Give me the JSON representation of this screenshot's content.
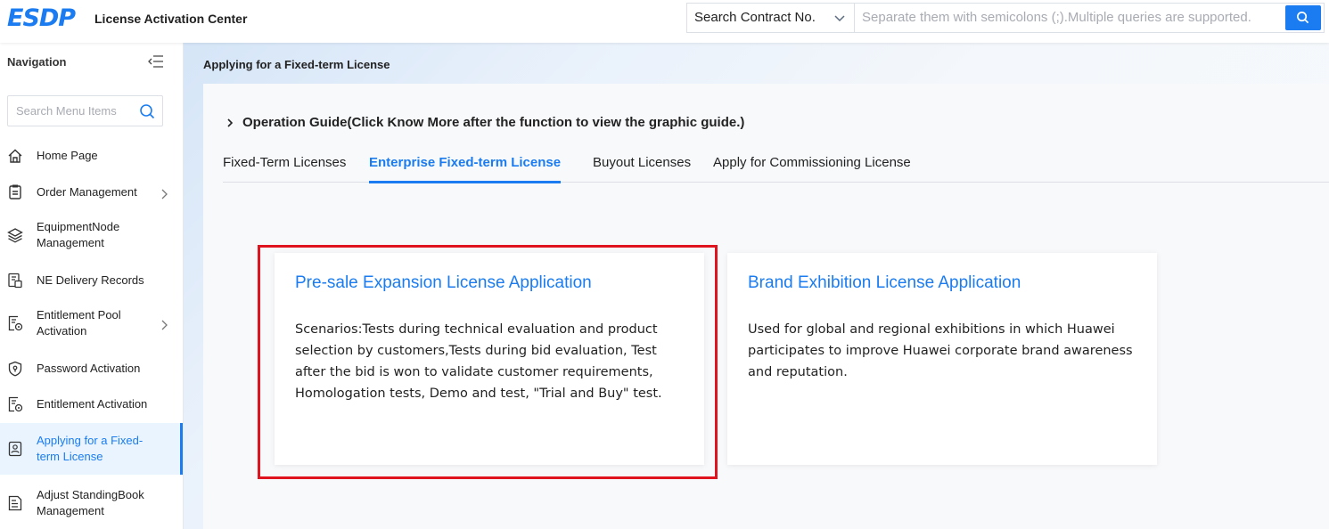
{
  "header": {
    "logo": "ESDP",
    "app_title": "License Activation Center",
    "search_type": "Search Contract No.",
    "search_placeholder": "Separate them with semicolons (;).Multiple queries are supported."
  },
  "sidebar": {
    "title": "Navigation",
    "search_placeholder": "Search Menu Items",
    "items": [
      {
        "label": "Home Page",
        "icon": "home-icon",
        "arrow": false
      },
      {
        "label": "Order Management",
        "icon": "clipboard-icon",
        "arrow": true
      },
      {
        "label": "EquipmentNode Management",
        "icon": "layers-icon",
        "arrow": false
      },
      {
        "label": "NE Delivery Records",
        "icon": "document-copy-icon",
        "arrow": false
      },
      {
        "label": "Entitlement Pool Activation",
        "icon": "document-settings-icon",
        "arrow": true
      },
      {
        "label": "Password Activation",
        "icon": "shield-icon",
        "arrow": false
      },
      {
        "label": "Entitlement Activation",
        "icon": "document-settings-icon",
        "arrow": false
      },
      {
        "label": "Applying for a Fixed-term License",
        "icon": "id-card-icon",
        "arrow": false,
        "active": true
      },
      {
        "label": "Adjust StandingBook Management",
        "icon": "list-document-icon",
        "arrow": false
      }
    ]
  },
  "main": {
    "page_title": "Applying for a Fixed-term License",
    "guide": "Operation Guide(Click Know More after the function to view the graphic guide.)",
    "tabs": [
      {
        "label": "Fixed-Term Licenses"
      },
      {
        "label": "Enterprise Fixed-term License",
        "active": true
      },
      {
        "label": "Buyout Licenses"
      },
      {
        "label": "Apply for Commissioning License"
      }
    ],
    "cards": [
      {
        "title": "Pre-sale Expansion License Application",
        "description": "Scenarios:Tests during technical evaluation and product selection by customers,Tests during bid evaluation, Test after the bid is won to validate customer requirements, Homologation tests, Demo and test, \"Trial and Buy\" test."
      },
      {
        "title": "Brand Exhibition License Application",
        "description": "Used for global and regional exhibitions in which Huawei participates to improve Huawei corporate brand awareness and reputation."
      }
    ]
  },
  "colors": {
    "accent": "#1a7cf0",
    "highlight_border": "#e0141e"
  }
}
